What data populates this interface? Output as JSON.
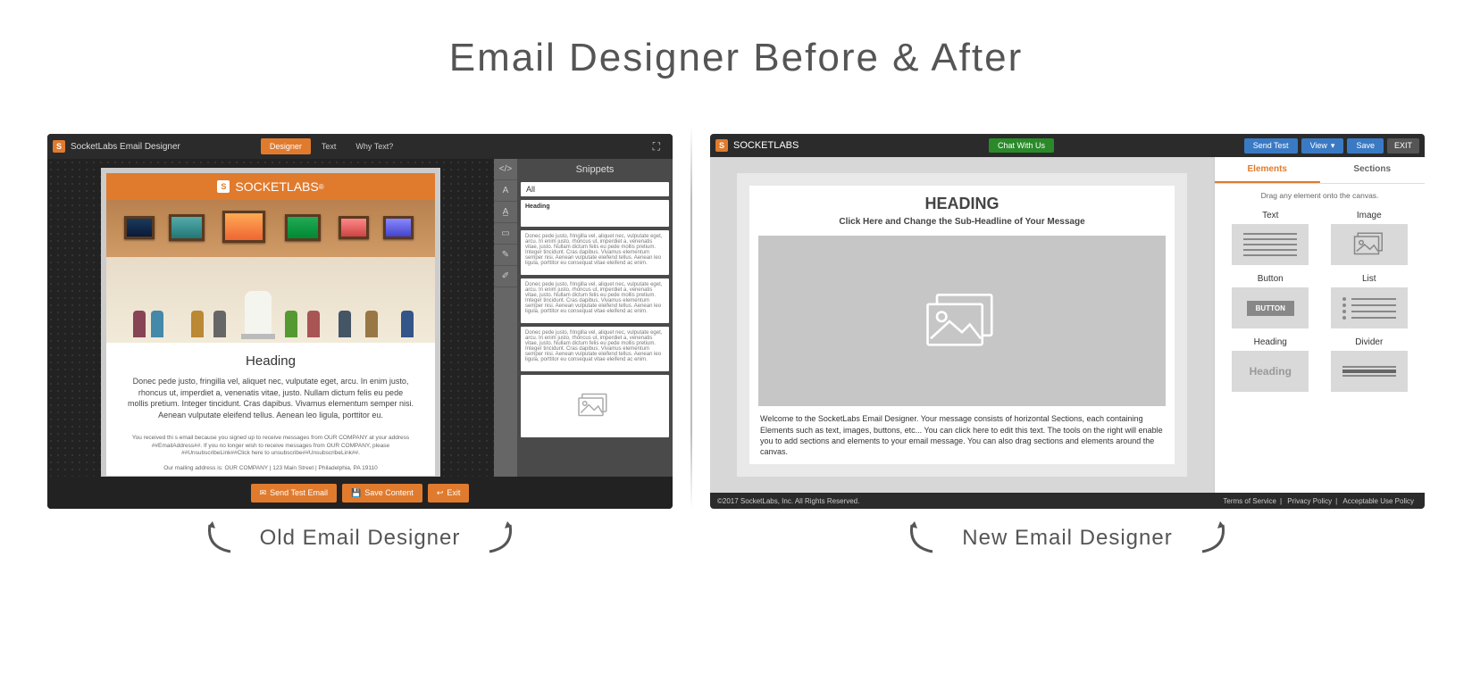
{
  "page_title": "Email Designer Before & After",
  "old": {
    "app_title": "SocketLabs Email Designer",
    "tabs": {
      "designer": "Designer",
      "text": "Text",
      "why_text": "Why Text?"
    },
    "logo_text": "SOCKETLABS",
    "heading": "Heading",
    "paragraph": "Donec pede justo, fringilla vel, aliquet nec, vulputate eget, arcu. In enim justo, rhoncus ut, imperdiet a, venenatis vitae, justo. Nullam dictum felis eu pede mollis pretium. Integer tincidunt. Cras dapibus. Vivamus elementum semper nisi. Aenean vulputate eleifend tellus. Aenean leo ligula, porttitor eu.",
    "footer1": "You received thi s email because you signed up to receive messages from OUR COMPANY at your address ##EmailAddress##. If you no longer wish to receive messages from OUR COMPANY, please ##UnsubscribeLink##Click here to unsubscribe##UnsubscribeLink##.",
    "footer2": "Our mailing address is: OUR COMPANY | 123 Main Street | Philadelphia, PA 19110",
    "snippets": {
      "title": "Snippets",
      "filter": "All",
      "heading_label": "Heading",
      "lorem": "Donec pede justo, fringilla vel, aliquet nec, vulputate eget, arcu. In enim justo, rhoncus ut, imperdiet a, venenatis vitae, justo. Nullam dictum felis eu pede mollis pretium. Integer tincidunt. Cras dapibus. Vivamus elementum semper nisi. Aenean vulputate eleifend tellus. Aenean leo ligula, porttitor eu consequat vitae eleifend ac enim."
    },
    "actions": {
      "send": "Send Test Email",
      "save": "Save Content",
      "exit": "Exit"
    },
    "caption": "Old Email Designer"
  },
  "new": {
    "logo_text": "SOCKETLABS",
    "chat": "Chat With Us",
    "buttons": {
      "send_test": "Send Test",
      "view": "View",
      "save": "Save",
      "exit": "EXIT"
    },
    "heading": "HEADING",
    "subheading": "Click Here and Change the Sub-Headline of Your Message",
    "welcome": "Welcome to the SocketLabs Email Designer. Your message consists of horizontal Sections, each containing Elements such as text, images, buttons, etc... You can click here to edit this text. The tools on the right will enable you to add sections and elements to your email message. You can also drag sections and elements around the canvas.",
    "sidebar": {
      "tabs": {
        "elements": "Elements",
        "sections": "Sections"
      },
      "hint": "Drag any element onto the canvas.",
      "items": {
        "text": "Text",
        "image": "Image",
        "button": "Button",
        "button_inner": "BUTTON",
        "list": "List",
        "heading": "Heading",
        "heading_inner": "Heading",
        "divider": "Divider"
      }
    },
    "footer": {
      "copyright": "©2017 SocketLabs, Inc. All Rights Reserved.",
      "tos": "Terms of Service",
      "privacy": "Privacy Policy",
      "aup": "Acceptable Use Policy"
    },
    "caption": "New Email Designer"
  }
}
